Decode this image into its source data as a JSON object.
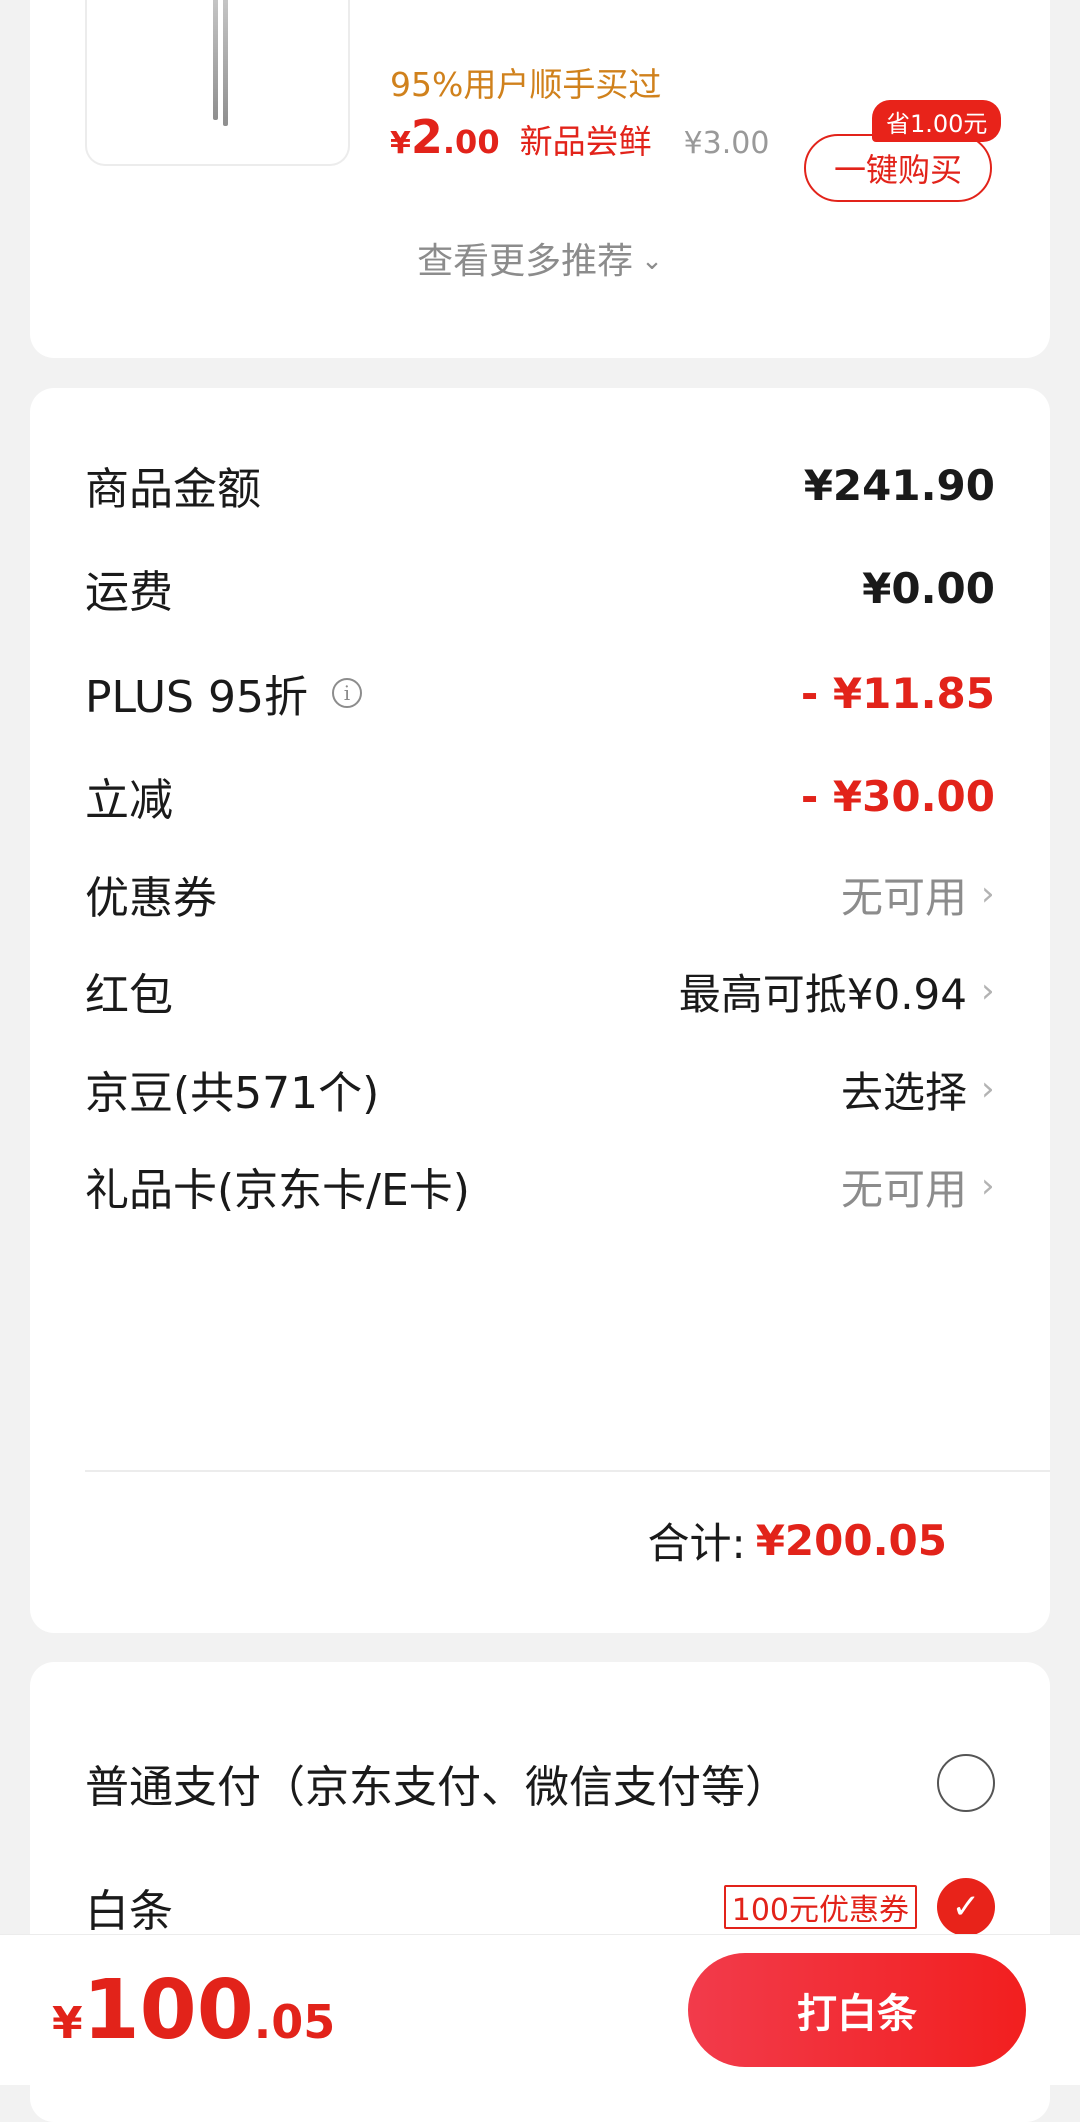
{
  "recommendation": {
    "tag": "95%用户顺手买过",
    "price_currency": "¥",
    "price_int": "2",
    "price_dec": ".00",
    "price_label": "新品尝鲜",
    "original_price": "¥3.00",
    "save_badge": "省1.00元",
    "buy_button": "一键购买",
    "see_more": "查看更多推荐",
    "see_more_icon": "chevron-down-icon"
  },
  "summary": {
    "rows": [
      {
        "label": "商品金额",
        "value": "¥241.90"
      },
      {
        "label": "运费",
        "value": "¥0.00"
      },
      {
        "label": "PLUS 95折",
        "value": "- ¥11.85"
      },
      {
        "label": "立减",
        "value": "- ¥30.00"
      },
      {
        "label": "优惠券",
        "value": "无可用"
      },
      {
        "label": "红包",
        "value": "最高可抵¥0.94"
      },
      {
        "label": "京豆(共571个)",
        "value": "去选择"
      },
      {
        "label": "礼品卡(京东卡/E卡)",
        "value": "无可用"
      }
    ],
    "info_icon": "i",
    "arrow": "›",
    "total_label": "合计:",
    "total_value": "¥200.05"
  },
  "payment": {
    "options": [
      {
        "label": "普通支付（京东支付、微信支付等）",
        "selected": false
      },
      {
        "label": "白条",
        "selected": true,
        "coupon": "100元优惠券"
      }
    ],
    "check_mark": "✓"
  },
  "bottom_bar": {
    "currency": "¥",
    "amount_int": "100",
    "amount_dec": ".05",
    "submit_label": "打白条"
  },
  "colors": {
    "accent_red": "#e2231a",
    "tag_orange": "#d0811c",
    "muted_gray": "#8c8c8c"
  }
}
